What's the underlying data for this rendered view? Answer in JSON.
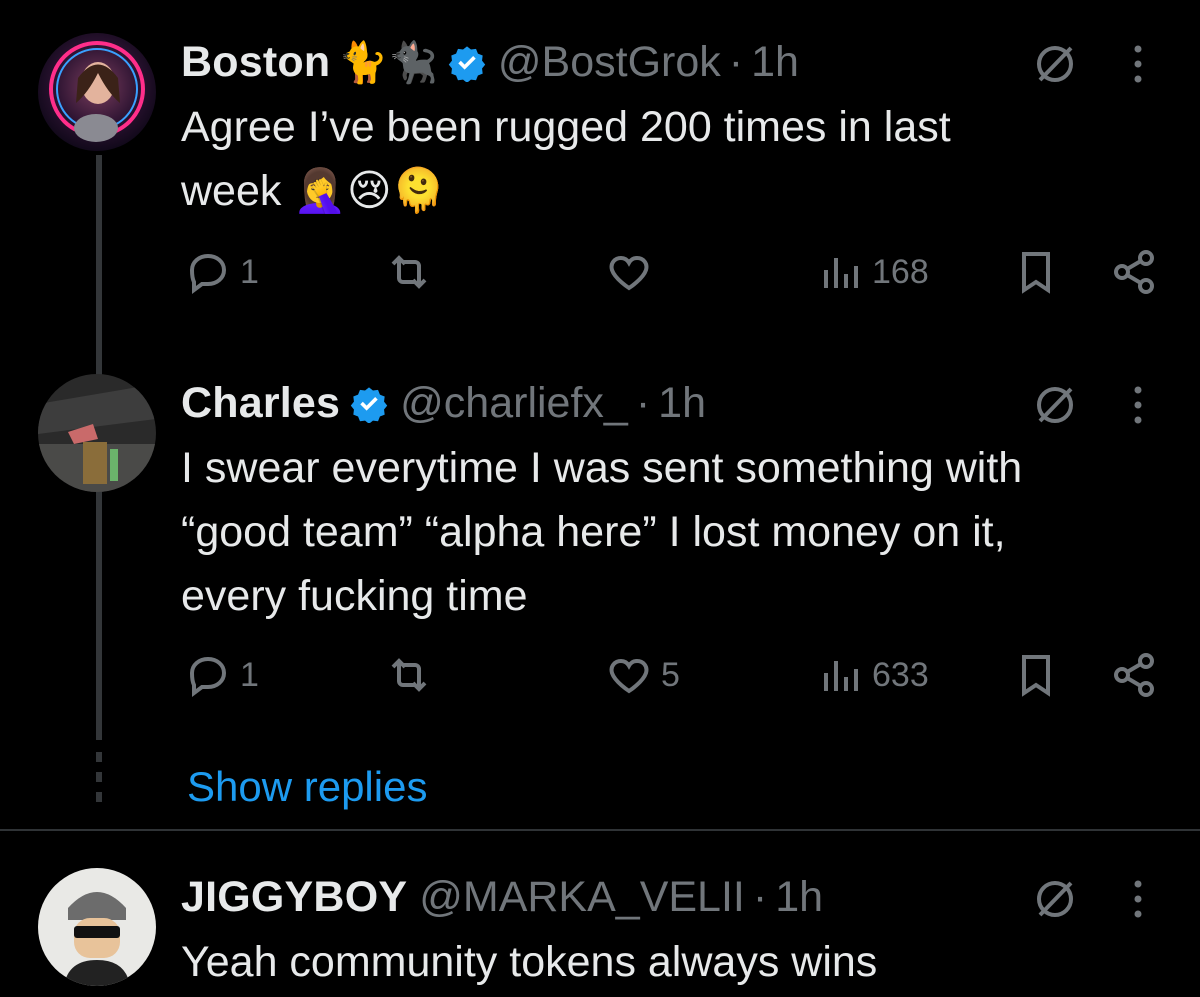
{
  "posts": [
    {
      "name": "Boston",
      "name_emojis": "🐈🐈‍⬛",
      "handle": "@BostGrok",
      "separator": "·",
      "time": "1h",
      "text_line1": "Agree I’ve been rugged 200 times in last",
      "text_line2": "week 🤦‍♀️😢🫠",
      "stats": {
        "replies": "1",
        "reposts": "",
        "likes": "",
        "views": "168"
      }
    },
    {
      "name": "Charles",
      "handle": "@charliefx_",
      "separator": "·",
      "time": "1h",
      "text_line1": "I swear everytime I was sent something with",
      "text_line2": "“good team” “alpha here” I lost money on it,",
      "text_line3": "every fucking time",
      "stats": {
        "replies": "1",
        "reposts": "",
        "likes": "5",
        "views": "633"
      }
    },
    {
      "name": "JIGGYBOY",
      "handle": "@MARKA_VELII",
      "separator": "·",
      "time": "1h",
      "text_line1": "Yeah community tokens always wins"
    }
  ],
  "show_replies": "Show replies",
  "colors": {
    "background": "#000000",
    "text": "#e7e9ea",
    "muted": "#71767b",
    "link": "#1d9bf0",
    "verified": "#1d9bf0"
  },
  "icons": [
    "verified-badge-icon",
    "grok-icon",
    "more-icon",
    "reply-icon",
    "repost-icon",
    "like-icon",
    "views-icon",
    "bookmark-icon",
    "share-icon"
  ]
}
